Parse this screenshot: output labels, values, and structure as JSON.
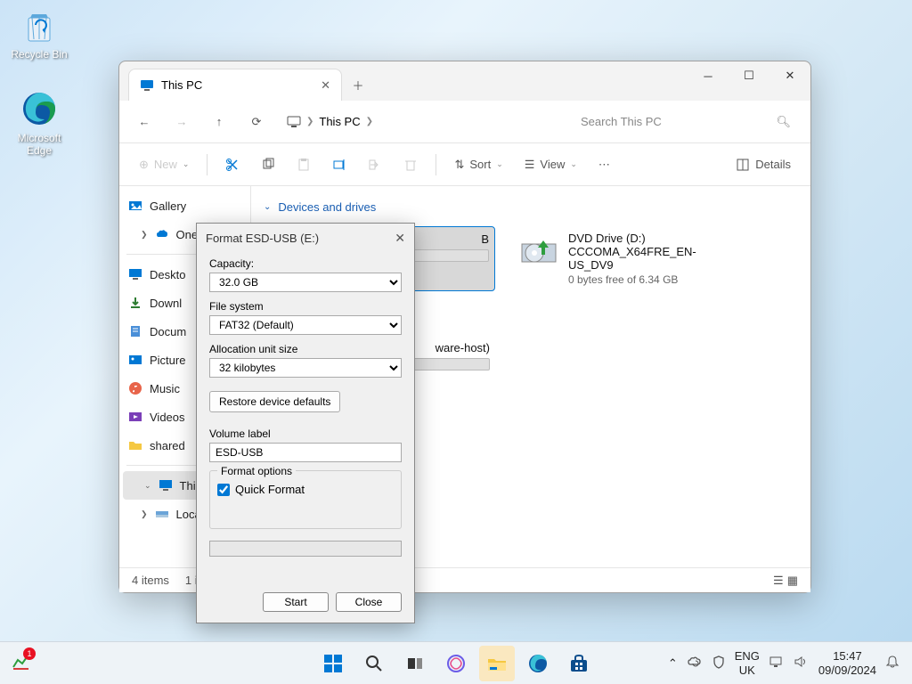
{
  "desktop": {
    "recycle": "Recycle Bin",
    "edge": "Microsoft Edge"
  },
  "explorer": {
    "tab_title": "This PC",
    "breadcrumb": "This PC",
    "search_placeholder": "Search This PC",
    "toolbar": {
      "new": "New",
      "sort": "Sort",
      "view": "View",
      "details": "Details"
    },
    "sidebar": {
      "gallery": "Gallery",
      "onedrive": "OneDri",
      "desktop": "Deskto",
      "downloads": "Downl",
      "documents": "Docum",
      "pictures": "Picture",
      "music": "Music",
      "videos": "Videos",
      "shared": "shared",
      "thispc": "This PC",
      "local": "Local"
    },
    "section": "Devices and drives",
    "drives": {
      "usb": {
        "name": "B",
        "free": ""
      },
      "dvd": {
        "name": "DVD Drive (D:)",
        "sub": "CCCOMA_X64FRE_EN-US_DV9",
        "free": "0 bytes free of 6.34 GB"
      },
      "net": {
        "name": "ware-host)",
        "fill": 36
      }
    },
    "status": {
      "items": "4 items",
      "sel": "1 it"
    }
  },
  "dialog": {
    "title": "Format ESD-USB (E:)",
    "capacity_lbl": "Capacity:",
    "capacity": "32.0 GB",
    "fs_lbl": "File system",
    "fs": "FAT32 (Default)",
    "alloc_lbl": "Allocation unit size",
    "alloc": "32 kilobytes",
    "restore": "Restore device defaults",
    "vol_lbl": "Volume label",
    "vol": "ESD-USB",
    "fmt_opts": "Format options",
    "quick": "Quick Format",
    "start": "Start",
    "close": "Close"
  },
  "taskbar": {
    "lang1": "ENG",
    "lang2": "UK",
    "time": "15:47",
    "date": "09/09/2024"
  }
}
